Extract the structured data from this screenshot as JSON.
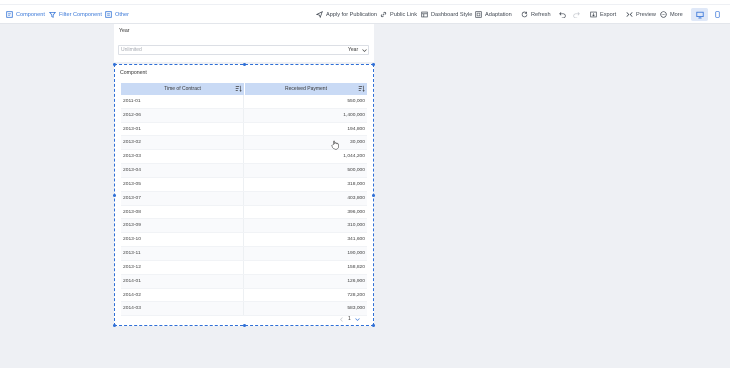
{
  "toolbar": {
    "left": [
      {
        "label": "Component",
        "icon": "component-icon"
      },
      {
        "label": "Filter Component",
        "icon": "filter-icon"
      },
      {
        "label": "Other",
        "icon": "other-icon"
      }
    ],
    "right": [
      {
        "label": "Apply for Publication",
        "icon": "send-icon"
      },
      {
        "label": "Public Link",
        "icon": "link-icon"
      },
      {
        "label": "Dashboard Style",
        "icon": "style-icon"
      },
      {
        "label": "Adaptation",
        "icon": "adaptation-icon"
      },
      {
        "label": "Refresh",
        "icon": "refresh-icon"
      },
      {
        "label": "Export",
        "icon": "export-icon"
      },
      {
        "label": "Preview",
        "icon": "preview-icon"
      },
      {
        "label": "More",
        "icon": "more-icon"
      }
    ],
    "accent_color": "#3a78d8"
  },
  "filter": {
    "title": "Year",
    "placeholder": "Unlimited",
    "unit": "Year"
  },
  "widget": {
    "title": "Component",
    "columns": [
      "Time of Contract",
      "Received Payment"
    ],
    "rows": [
      [
        "2011-01",
        "550,000"
      ],
      [
        "2012-06",
        "1,400,000"
      ],
      [
        "2013-01",
        "194,800"
      ],
      [
        "2013-02",
        "30,000"
      ],
      [
        "2013-03",
        "1,044,200"
      ],
      [
        "2013-04",
        "500,000"
      ],
      [
        "2013-05",
        "318,000"
      ],
      [
        "2013-07",
        "403,800"
      ],
      [
        "2013-08",
        "396,000"
      ],
      [
        "2013-09",
        "310,000"
      ],
      [
        "2013-10",
        "341,600"
      ],
      [
        "2013-11",
        "190,000"
      ],
      [
        "2013-12",
        "158,820"
      ],
      [
        "2014-01",
        "126,900"
      ],
      [
        "2014-02",
        "728,200"
      ],
      [
        "2014-03",
        "583,000"
      ]
    ],
    "page": "1",
    "header_color": "#c9daf5",
    "selection_color": "#2f6fd6"
  }
}
